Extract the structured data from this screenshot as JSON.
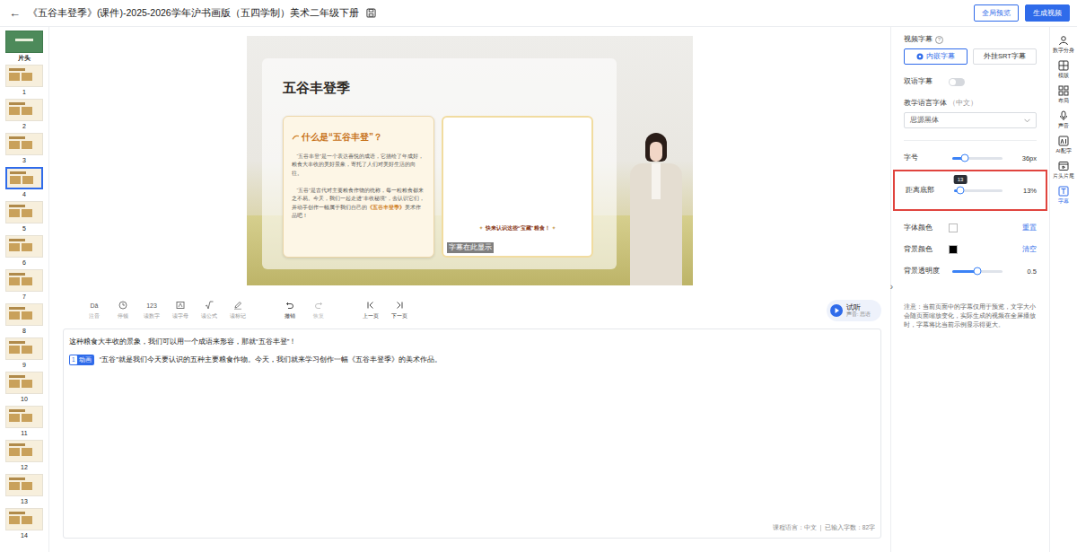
{
  "header": {
    "back": "←",
    "title": "《五谷丰登季》(课件)-2025-2026学年沪书画版（五四学制）美术二年级下册",
    "buttons": [
      {
        "label": "全局预览",
        "kind": "outline"
      },
      {
        "label": "生成视频",
        "kind": "primary"
      }
    ]
  },
  "slides": [
    {
      "label": "片头",
      "selected": false
    },
    {
      "label": "1",
      "selected": false
    },
    {
      "label": "2",
      "selected": false
    },
    {
      "label": "3",
      "selected": false
    },
    {
      "label": "4",
      "selected": true
    },
    {
      "label": "5",
      "selected": false
    },
    {
      "label": "6",
      "selected": false
    },
    {
      "label": "7",
      "selected": false
    },
    {
      "label": "8",
      "selected": false
    },
    {
      "label": "9",
      "selected": false
    },
    {
      "label": "10",
      "selected": false
    },
    {
      "label": "11",
      "selected": false
    },
    {
      "label": "12",
      "selected": false
    },
    {
      "label": "13",
      "selected": false
    },
    {
      "label": "14",
      "selected": false
    }
  ],
  "preview": {
    "title": "五谷丰登季",
    "heading": "什么是“五谷丰登”？",
    "paragraphs": [
      [
        {
          "text": "“五谷丰登”是一个表达喜悦的成语，它描绘了年成好，粮食大丰收的美好景象，寄托了人们对美好生活的向往。",
          "accent": false
        }
      ],
      [
        {
          "text": "“五谷”是古代对主要粮食作物的统称，每一粒粮食都来之不易。今天，我们一起走进“丰收秘境”，去认识它们，并动手创作一幅属于我们自己的",
          "accent": false
        },
        {
          "text": "《五谷丰登季》",
          "accent": true
        },
        {
          "text": "美术作品吧！",
          "accent": false
        }
      ]
    ],
    "caption_mark": "✦",
    "caption": "快来认识这些“宝藏”粮食！",
    "subtitle": "字幕在此显示"
  },
  "toolbar": {
    "tools": [
      {
        "label": "注音",
        "kind": "text",
        "glyph": "Dā"
      },
      {
        "label": "停顿",
        "kind": "clock",
        "glyph": ""
      },
      {
        "label": "读数字",
        "kind": "text",
        "glyph": "123"
      },
      {
        "label": "读字母",
        "kind": "letter",
        "glyph": ""
      },
      {
        "label": "读公式",
        "kind": "formula",
        "glyph": ""
      },
      {
        "label": "读标记",
        "kind": "pen",
        "glyph": ""
      }
    ],
    "history": [
      {
        "label": "撤销",
        "kind": "undo",
        "disabled": false
      },
      {
        "label": "恢复",
        "kind": "redo",
        "disabled": true
      }
    ],
    "nav": [
      {
        "label": "上一页",
        "kind": "prev"
      },
      {
        "label": "下一页",
        "kind": "next"
      }
    ],
    "listen": {
      "label": "试听",
      "voice": "声音: 思语"
    }
  },
  "collapse": "›",
  "editor": {
    "lines": [
      {
        "badge_num": "",
        "badge_label": "",
        "text": "这种粮食大丰收的景象，我们可以用一个成语来形容，那就“五谷丰登”！"
      },
      {
        "badge_num": "1",
        "badge_label": "动画",
        "text": "“五谷”就是我们今天要认识的五种主要粮食作物。今天，我们就来学习创作一幅《五谷丰登季》的美术作品。"
      }
    ],
    "footer": {
      "language": "课程语言：中文",
      "count": "已输入字数：82字"
    }
  },
  "settings": {
    "title": "视频字幕",
    "info": "?",
    "modes": [
      {
        "label": "内嵌字幕",
        "selected": true
      },
      {
        "label": "外挂SRT字幕",
        "selected": false
      }
    ],
    "bilingual": {
      "label": "双语字幕",
      "on": false
    },
    "font_label": "教学语言字体",
    "font_lang": "（中文）",
    "font_value": "思源黑体",
    "size": {
      "label": "字号",
      "level": 0.25,
      "reading": "36px"
    },
    "bottom": {
      "label": "距离底部",
      "level": 0.13,
      "reading": "13%",
      "tooltip": "13",
      "highlighted": true
    },
    "font_color": {
      "label": "字体颜色",
      "color": "#ffffff",
      "action": "重置"
    },
    "bg_color": {
      "label": "背景颜色",
      "color": "#000000",
      "action": "清空"
    },
    "opacity": {
      "label": "背景透明度",
      "level": 0.5,
      "reading": "0.5"
    },
    "note": "注意：当前页面中的字幕仅用于预览，文字大小会随页面缩放变化，实际生成的视频在全屏播放时，字幕将比当前示例显示得更大。"
  },
  "rail": [
    {
      "label": "数字分身",
      "kind": "avatar",
      "selected": false
    },
    {
      "label": "模版",
      "kind": "template",
      "selected": false
    },
    {
      "label": "布局",
      "kind": "layout",
      "selected": false
    },
    {
      "label": "声音",
      "kind": "mic",
      "selected": false
    },
    {
      "label": "AI配字",
      "kind": "ai",
      "selected": false
    },
    {
      "label": "片头片尾",
      "kind": "film",
      "selected": false
    },
    {
      "label": "字幕",
      "kind": "subtitle",
      "selected": true
    }
  ]
}
